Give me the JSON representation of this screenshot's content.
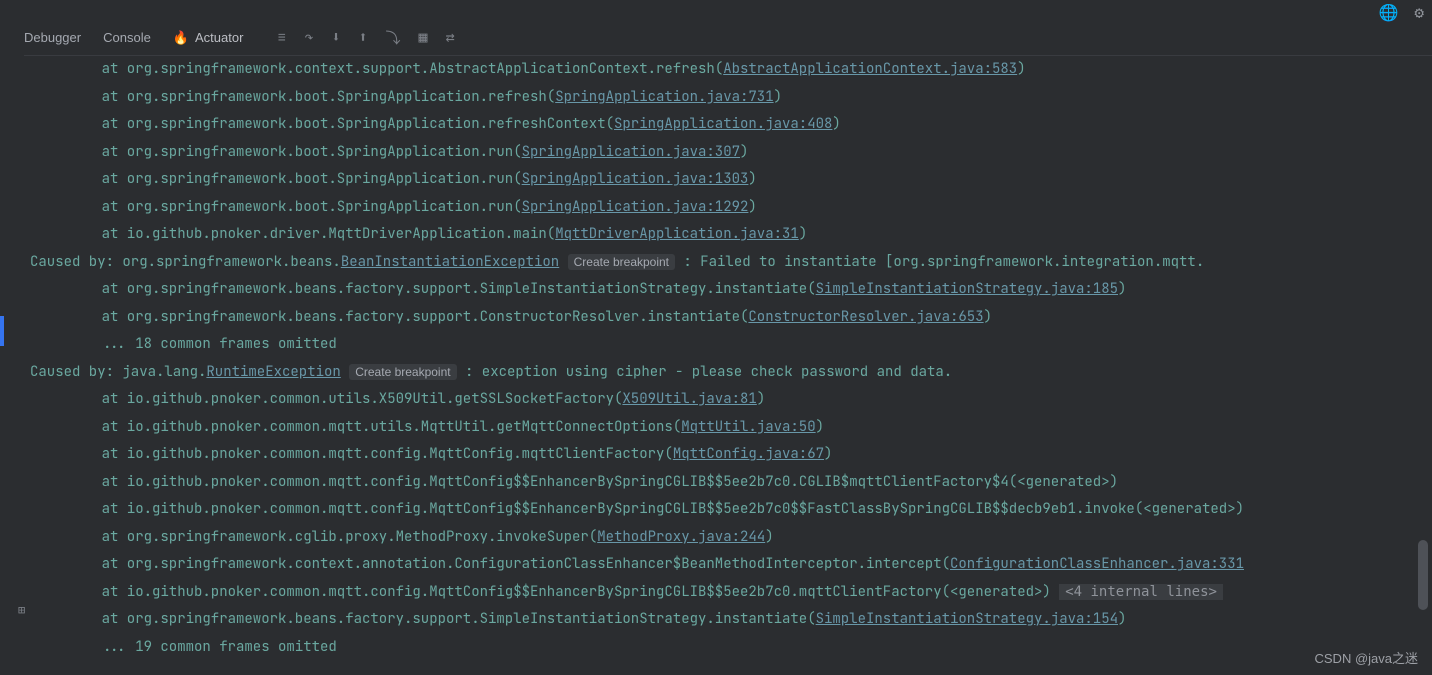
{
  "topIcons": {
    "globe": "🌐",
    "gear": "⚙"
  },
  "tabs": {
    "debugger": "Debugger",
    "console": "Console",
    "actuator": "Actuator",
    "flame": "🔥"
  },
  "toolIcons": [
    "≡",
    "↷",
    "⬇",
    "⬆",
    "⤵",
    "▦",
    "⇄"
  ],
  "lines": [
    {
      "pre": "    at org.springframework.context.support.AbstractApplicationContext.refresh(",
      "link": "AbstractApplicationContext.java:583",
      "post": ")"
    },
    {
      "pre": "    at org.springframework.boot.SpringApplication.refresh(",
      "link": "SpringApplication.java:731",
      "post": ")"
    },
    {
      "pre": "    at org.springframework.boot.SpringApplication.refreshContext(",
      "link": "SpringApplication.java:408",
      "post": ")"
    },
    {
      "pre": "    at org.springframework.boot.SpringApplication.run(",
      "link": "SpringApplication.java:307",
      "post": ")"
    },
    {
      "pre": "    at org.springframework.boot.SpringApplication.run(",
      "link": "SpringApplication.java:1303",
      "post": ")"
    },
    {
      "pre": "    at org.springframework.boot.SpringApplication.run(",
      "link": "SpringApplication.java:1292",
      "post": ")"
    },
    {
      "pre": "    at io.github.pnoker.driver.MqttDriverApplication.main(",
      "link": "MqttDriverApplication.java:31",
      "post": ")"
    },
    {
      "caused": true,
      "pre": "Caused by: org.springframework.beans.",
      "link": "BeanInstantiationException",
      "cb": "Create breakpoint",
      "post": " : Failed to instantiate [org.springframework.integration.mqtt."
    },
    {
      "pre": "    at org.springframework.beans.factory.support.SimpleInstantiationStrategy.instantiate(",
      "link": "SimpleInstantiationStrategy.java:185",
      "post": ")"
    },
    {
      "pre": "    at org.springframework.beans.factory.support.ConstructorResolver.instantiate(",
      "link": "ConstructorResolver.java:653",
      "post": ")"
    },
    {
      "ell": "    ... 18 common frames omitted"
    },
    {
      "caused": true,
      "pre": "Caused by: java.lang.",
      "link": "RuntimeException",
      "cb": "Create breakpoint",
      "post": " : exception using cipher - please check password and data."
    },
    {
      "pre": "    at io.github.pnoker.common.utils.X509Util.getSSLSocketFactory(",
      "link": "X509Util.java:81",
      "post": ")"
    },
    {
      "pre": "    at io.github.pnoker.common.mqtt.utils.MqttUtil.getMqttConnectOptions(",
      "link": "MqttUtil.java:50",
      "post": ")"
    },
    {
      "pre": "    at io.github.pnoker.common.mqtt.config.MqttConfig.mqttClientFactory(",
      "link": "MqttConfig.java:67",
      "post": ")"
    },
    {
      "plain": "    at io.github.pnoker.common.mqtt.config.MqttConfig$$EnhancerBySpringCGLIB$$5ee2b7c0.CGLIB$mqttClientFactory$4(<generated>)"
    },
    {
      "plain": "    at io.github.pnoker.common.mqtt.config.MqttConfig$$EnhancerBySpringCGLIB$$5ee2b7c0$$FastClassBySpringCGLIB$$decb9eb1.invoke(<generated>)"
    },
    {
      "pre": "    at org.springframework.cglib.proxy.MethodProxy.invokeSuper(",
      "link": "MethodProxy.java:244",
      "post": ")"
    },
    {
      "pre": "    at org.springframework.context.annotation.ConfigurationClassEnhancer$BeanMethodInterceptor.intercept(",
      "link": "ConfigurationClassEnhancer.java:331",
      "post": ""
    },
    {
      "plain": "    at io.github.pnoker.common.mqtt.config.MqttConfig$$EnhancerBySpringCGLIB$$5ee2b7c0.mqttClientFactory(<generated>) ",
      "hint": "<4 internal lines>"
    },
    {
      "pre": "    at org.springframework.beans.factory.support.SimpleInstantiationStrategy.instantiate(",
      "link": "SimpleInstantiationStrategy.java:154",
      "post": ")"
    },
    {
      "ell": "    ... 19 common frames omitted"
    }
  ],
  "watermark": "CSDN @java之迷",
  "gutterPlus": "⊞"
}
